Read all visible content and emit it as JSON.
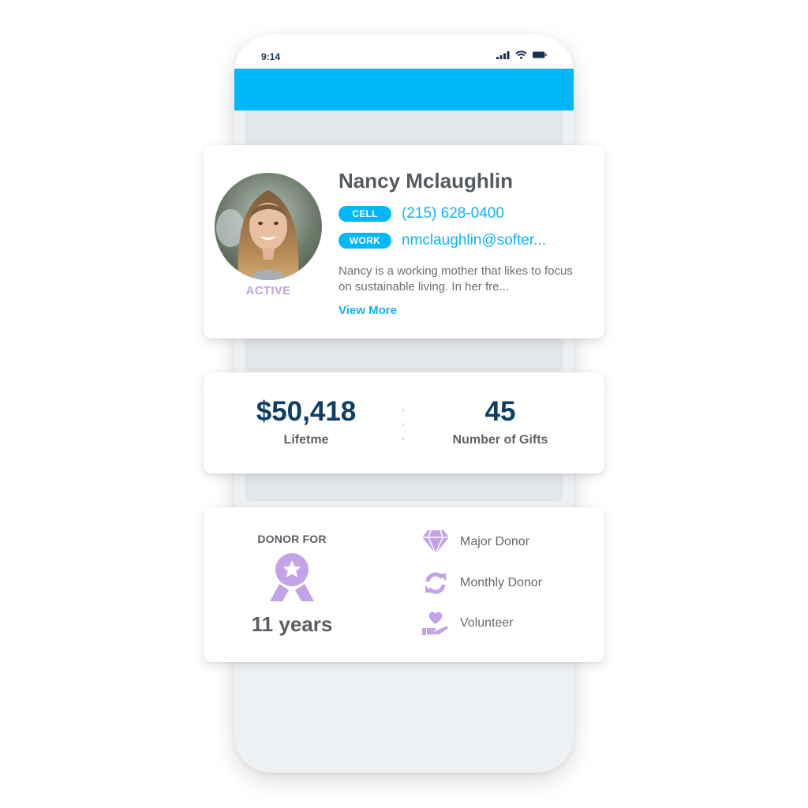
{
  "status_bar": {
    "time": "9:14",
    "icons": [
      "signal-icon",
      "wifi-icon",
      "battery-icon"
    ]
  },
  "colors": {
    "header": "#00b8f9",
    "accent_blue": "#10b3f2",
    "stat_navy": "#0f3e66",
    "purple": "#c3a2ea"
  },
  "profile": {
    "name": "Nancy Mclaughlin",
    "status": "ACTIVE",
    "contacts": [
      {
        "label": "CELL",
        "value": "(215) 628-0400"
      },
      {
        "label": "WORK",
        "value": "nmclaughlin@softer..."
      }
    ],
    "bio": "Nancy is a working mother that likes to focus on sustainable living. In her fre...",
    "view_more": "View More"
  },
  "stats": {
    "lifetime": {
      "value": "$50,418",
      "label": "Lifetme"
    },
    "gifts": {
      "value": "45",
      "label": "Number of Gifts"
    }
  },
  "donor": {
    "heading": "DONOR FOR",
    "duration": "11 years",
    "icon": "award-ribbon-icon",
    "tags": [
      {
        "label": "Major Donor",
        "icon": "diamond-icon"
      },
      {
        "label": "Monthly Donor",
        "icon": "recurring-icon"
      },
      {
        "label": "Volunteer",
        "icon": "heart-hand-icon"
      }
    ]
  }
}
